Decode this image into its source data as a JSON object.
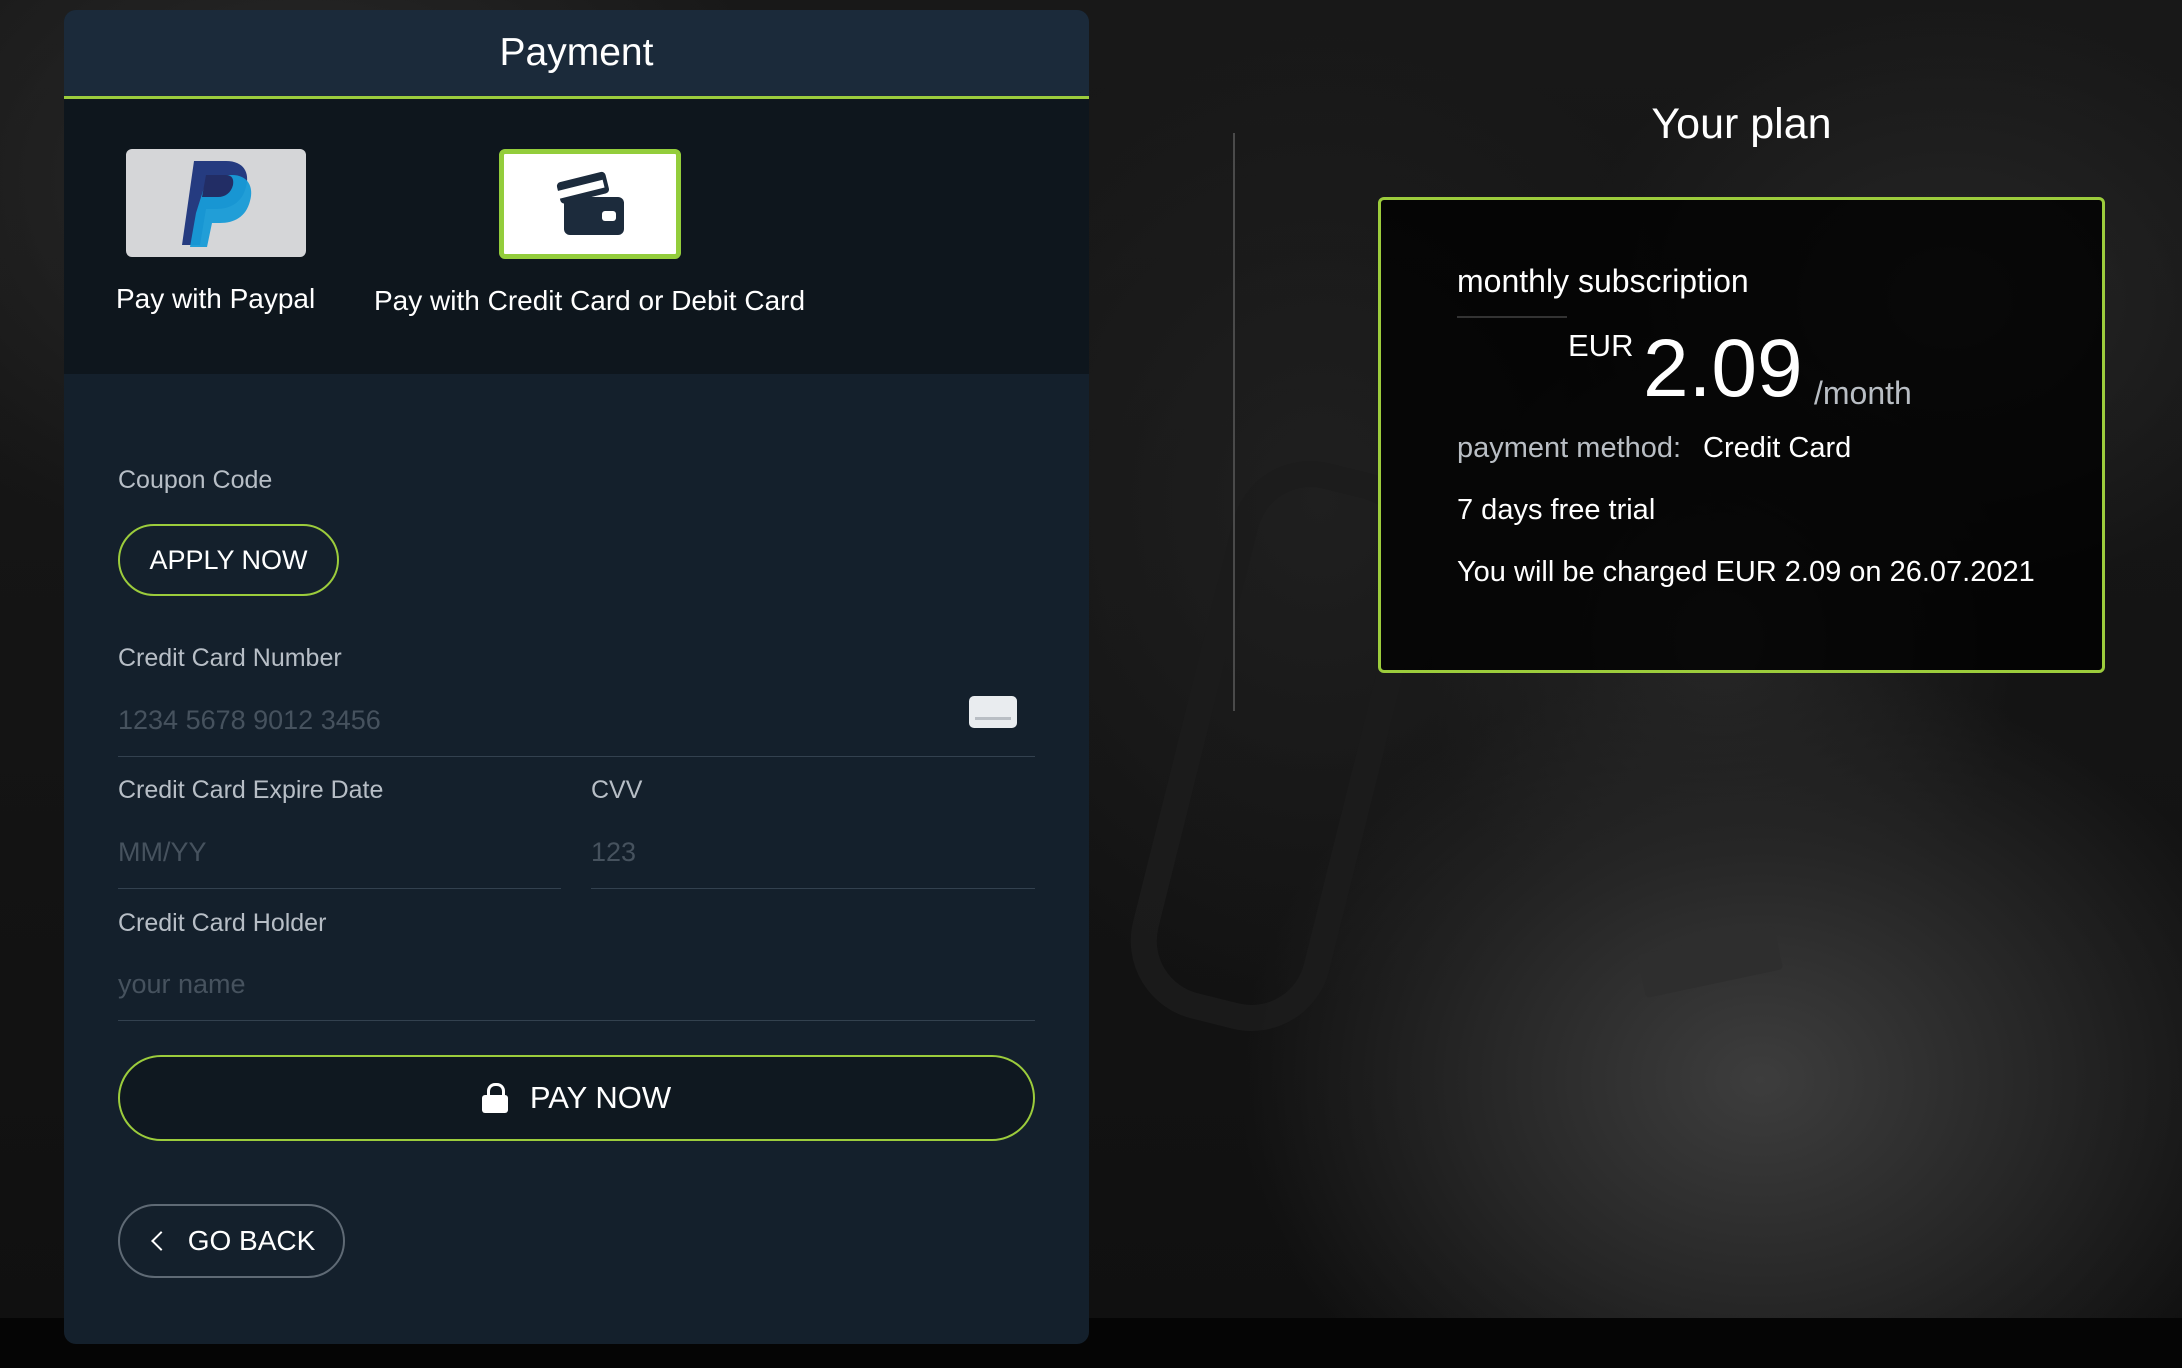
{
  "payment": {
    "title": "Payment",
    "methods": [
      {
        "id": "paypal",
        "label": "Pay with Paypal",
        "icon": "paypal-logo-icon"
      },
      {
        "id": "card",
        "label": "Pay with Credit Card or Debit Card",
        "icon": "credit-card-icon",
        "selected": true
      }
    ],
    "coupon": {
      "label": "Coupon Code",
      "apply_label": "APPLY NOW"
    },
    "card_number": {
      "label": "Credit Card Number",
      "placeholder": "1234 5678 9012 3456"
    },
    "expiry": {
      "label": "Credit Card Expire Date",
      "placeholder": "MM/YY"
    },
    "cvv": {
      "label": "CVV",
      "placeholder": "123"
    },
    "holder": {
      "label": "Credit Card Holder",
      "placeholder": "your name"
    },
    "pay_label": "PAY NOW",
    "back_label": "GO BACK"
  },
  "plan": {
    "title": "Your plan",
    "name": "monthly subscription",
    "currency": "EUR",
    "amount": "2.09",
    "period": "/month",
    "payment_method_label": "payment method:",
    "payment_method_value": "Credit Card",
    "trial": "7 days free trial",
    "charge_note": "You will be charged EUR 2.09 on 26.07.2021"
  },
  "colors": {
    "accent": "#9ccc3c",
    "panel_bg": "#14202c",
    "header_bg": "#1b2a3a"
  }
}
